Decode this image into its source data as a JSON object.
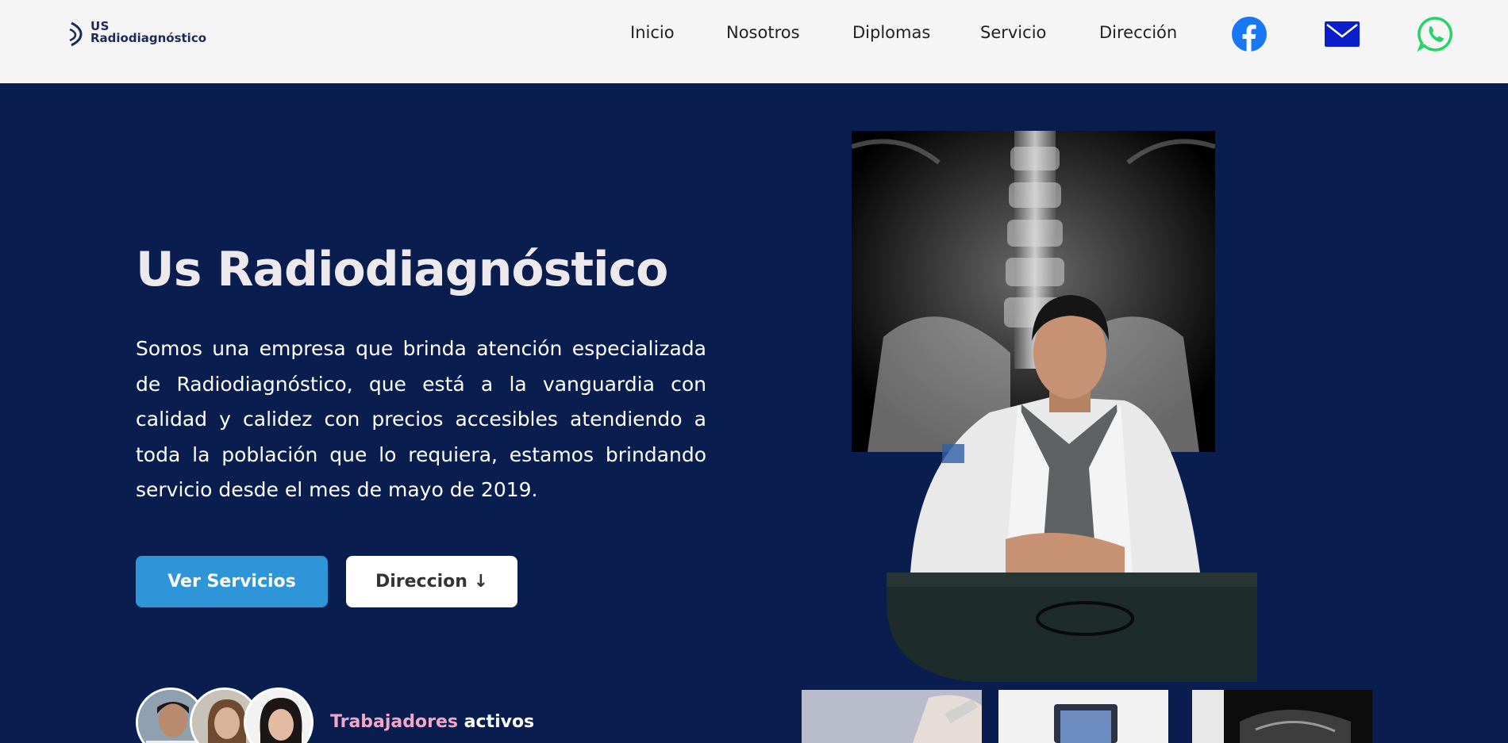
{
  "nav": {
    "logo_line1": "US",
    "logo_line2": "Radiodiagnóstico",
    "links": [
      "Inicio",
      "Nosotros",
      "Diplomas",
      "Servicio",
      "Dirección"
    ],
    "icons": [
      "facebook-icon",
      "mail-icon",
      "whatsapp-icon"
    ]
  },
  "hero": {
    "title": "Us Radiodiagnóstico",
    "description": "Somos una empresa que brinda atención especializada de Radiodiagnóstico, que está a la vanguardia con calidad y calidez con precios accesibles atendiendo a toda la población que lo requiera, estamos brindando servicio desde el mes de mayo de 2019.",
    "btn_primary": "Ver Servicios",
    "btn_secondary": "Direccion ↓",
    "workers_highlight": "Trabajadores",
    "workers_rest": " activos"
  },
  "colors": {
    "hero_bg": "#0a1d4f",
    "nav_bg": "#f5f5f5",
    "primary_button": "#2f95d9",
    "highlight": "#f4a6c8",
    "facebook": "#1877f2",
    "mail": "#0a1fc9",
    "whatsapp": "#25d366"
  }
}
